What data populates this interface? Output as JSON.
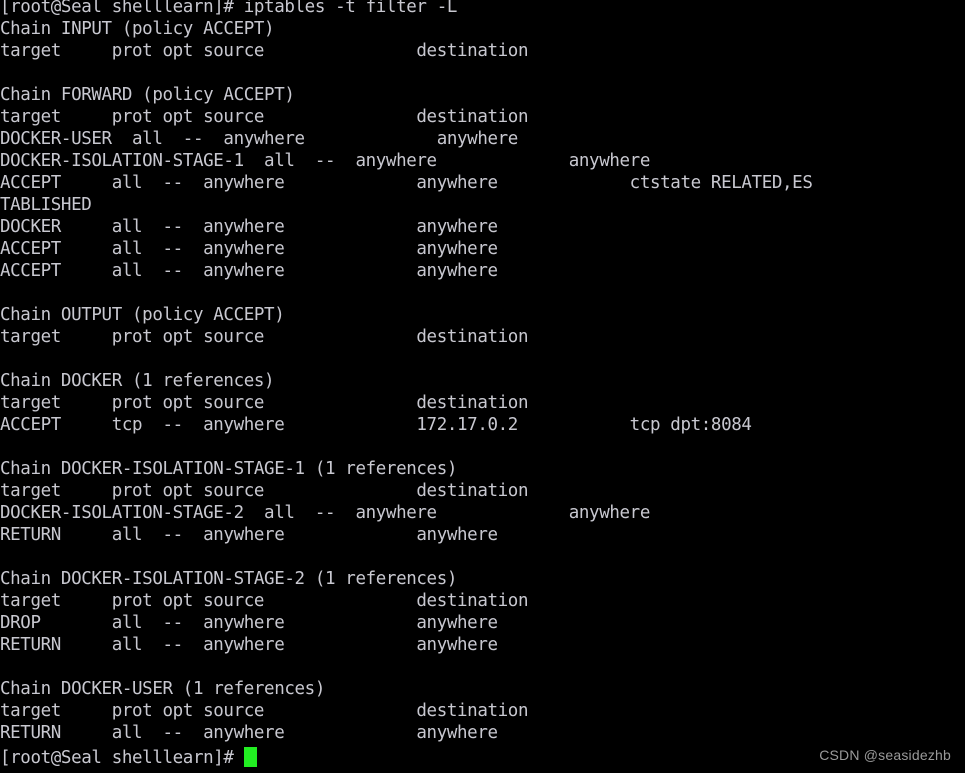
{
  "terminal": {
    "title": "iptables -t filter -L output",
    "background_color": "#000000",
    "text_color": "#c8c8d0",
    "cursor_color": "#22ee22",
    "prompt": "[root@Seal shelllearn]# ",
    "command": "iptables -t filter -L",
    "lines": [
      "[root@Seal shelllearn]# iptables -t filter -L",
      "Chain INPUT (policy ACCEPT)",
      "target     prot opt source               destination",
      "",
      "Chain FORWARD (policy ACCEPT)",
      "target     prot opt source               destination",
      "DOCKER-USER  all  --  anywhere             anywhere",
      "DOCKER-ISOLATION-STAGE-1  all  --  anywhere             anywhere",
      "ACCEPT     all  --  anywhere             anywhere             ctstate RELATED,ES",
      "TABLISHED",
      "DOCKER     all  --  anywhere             anywhere",
      "ACCEPT     all  --  anywhere             anywhere",
      "ACCEPT     all  --  anywhere             anywhere",
      "",
      "Chain OUTPUT (policy ACCEPT)",
      "target     prot opt source               destination",
      "",
      "Chain DOCKER (1 references)",
      "target     prot opt source               destination",
      "ACCEPT     tcp  --  anywhere             172.17.0.2           tcp dpt:8084",
      "",
      "Chain DOCKER-ISOLATION-STAGE-1 (1 references)",
      "target     prot opt source               destination",
      "DOCKER-ISOLATION-STAGE-2  all  --  anywhere             anywhere",
      "RETURN     all  --  anywhere             anywhere",
      "",
      "Chain DOCKER-ISOLATION-STAGE-2 (1 references)",
      "target     prot opt source               destination",
      "DROP       all  --  anywhere             anywhere",
      "RETURN     all  --  anywhere             anywhere",
      "",
      "Chain DOCKER-USER (1 references)",
      "target     prot opt source               destination",
      "RETURN     all  --  anywhere             anywhere"
    ]
  },
  "watermark": {
    "text": "CSDN @seasidezhb",
    "color": "#9a9a9a"
  }
}
